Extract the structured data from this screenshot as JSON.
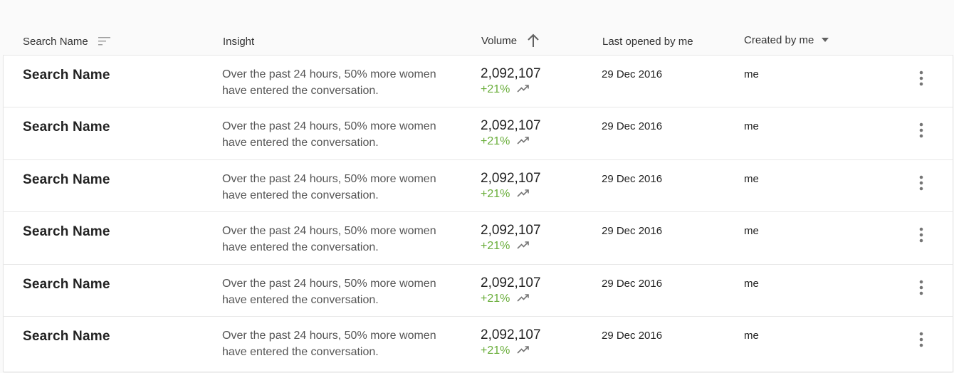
{
  "header": {
    "search_name": "Search Name",
    "insight": "Insight",
    "volume": "Volume",
    "last_opened": "Last opened by me",
    "created": "Created by me"
  },
  "rows": [
    {
      "name": "Search Name",
      "insight": "Over the past 24 hours, 50% more women have entered the conversation.",
      "volume": "2,092,107",
      "change": "+21%",
      "last_opened": "29 Dec 2016",
      "created_by": "me"
    },
    {
      "name": "Search Name",
      "insight": "Over the past 24 hours, 50% more women have entered the conversation.",
      "volume": "2,092,107",
      "change": "+21%",
      "last_opened": "29 Dec 2016",
      "created_by": "me"
    },
    {
      "name": "Search Name",
      "insight": "Over the past 24 hours, 50% more women have entered the conversation.",
      "volume": "2,092,107",
      "change": "+21%",
      "last_opened": "29 Dec 2016",
      "created_by": "me"
    },
    {
      "name": "Search Name",
      "insight": "Over the past 24 hours, 50% more women have entered the conversation.",
      "volume": "2,092,107",
      "change": "+21%",
      "last_opened": "29 Dec 2016",
      "created_by": "me"
    },
    {
      "name": "Search Name",
      "insight": "Over the past 24 hours, 50% more women have entered the conversation.",
      "volume": "2,092,107",
      "change": "+21%",
      "last_opened": "29 Dec 2016",
      "created_by": "me"
    },
    {
      "name": "Search Name",
      "insight": "Over the past 24 hours, 50% more women have entered the conversation.",
      "volume": "2,092,107",
      "change": "+21%",
      "last_opened": "29 Dec 2016",
      "created_by": "me"
    }
  ],
  "icons": {
    "sort": "sort-icon",
    "volume_sort": "arrow-up-icon",
    "created_filter": "caret-down-icon",
    "trend": "trending-up-icon",
    "row_menu": "more-vert-icon"
  },
  "colors": {
    "positive_change": "#6aae3b",
    "background": "#fafafa",
    "card": "#ffffff"
  }
}
